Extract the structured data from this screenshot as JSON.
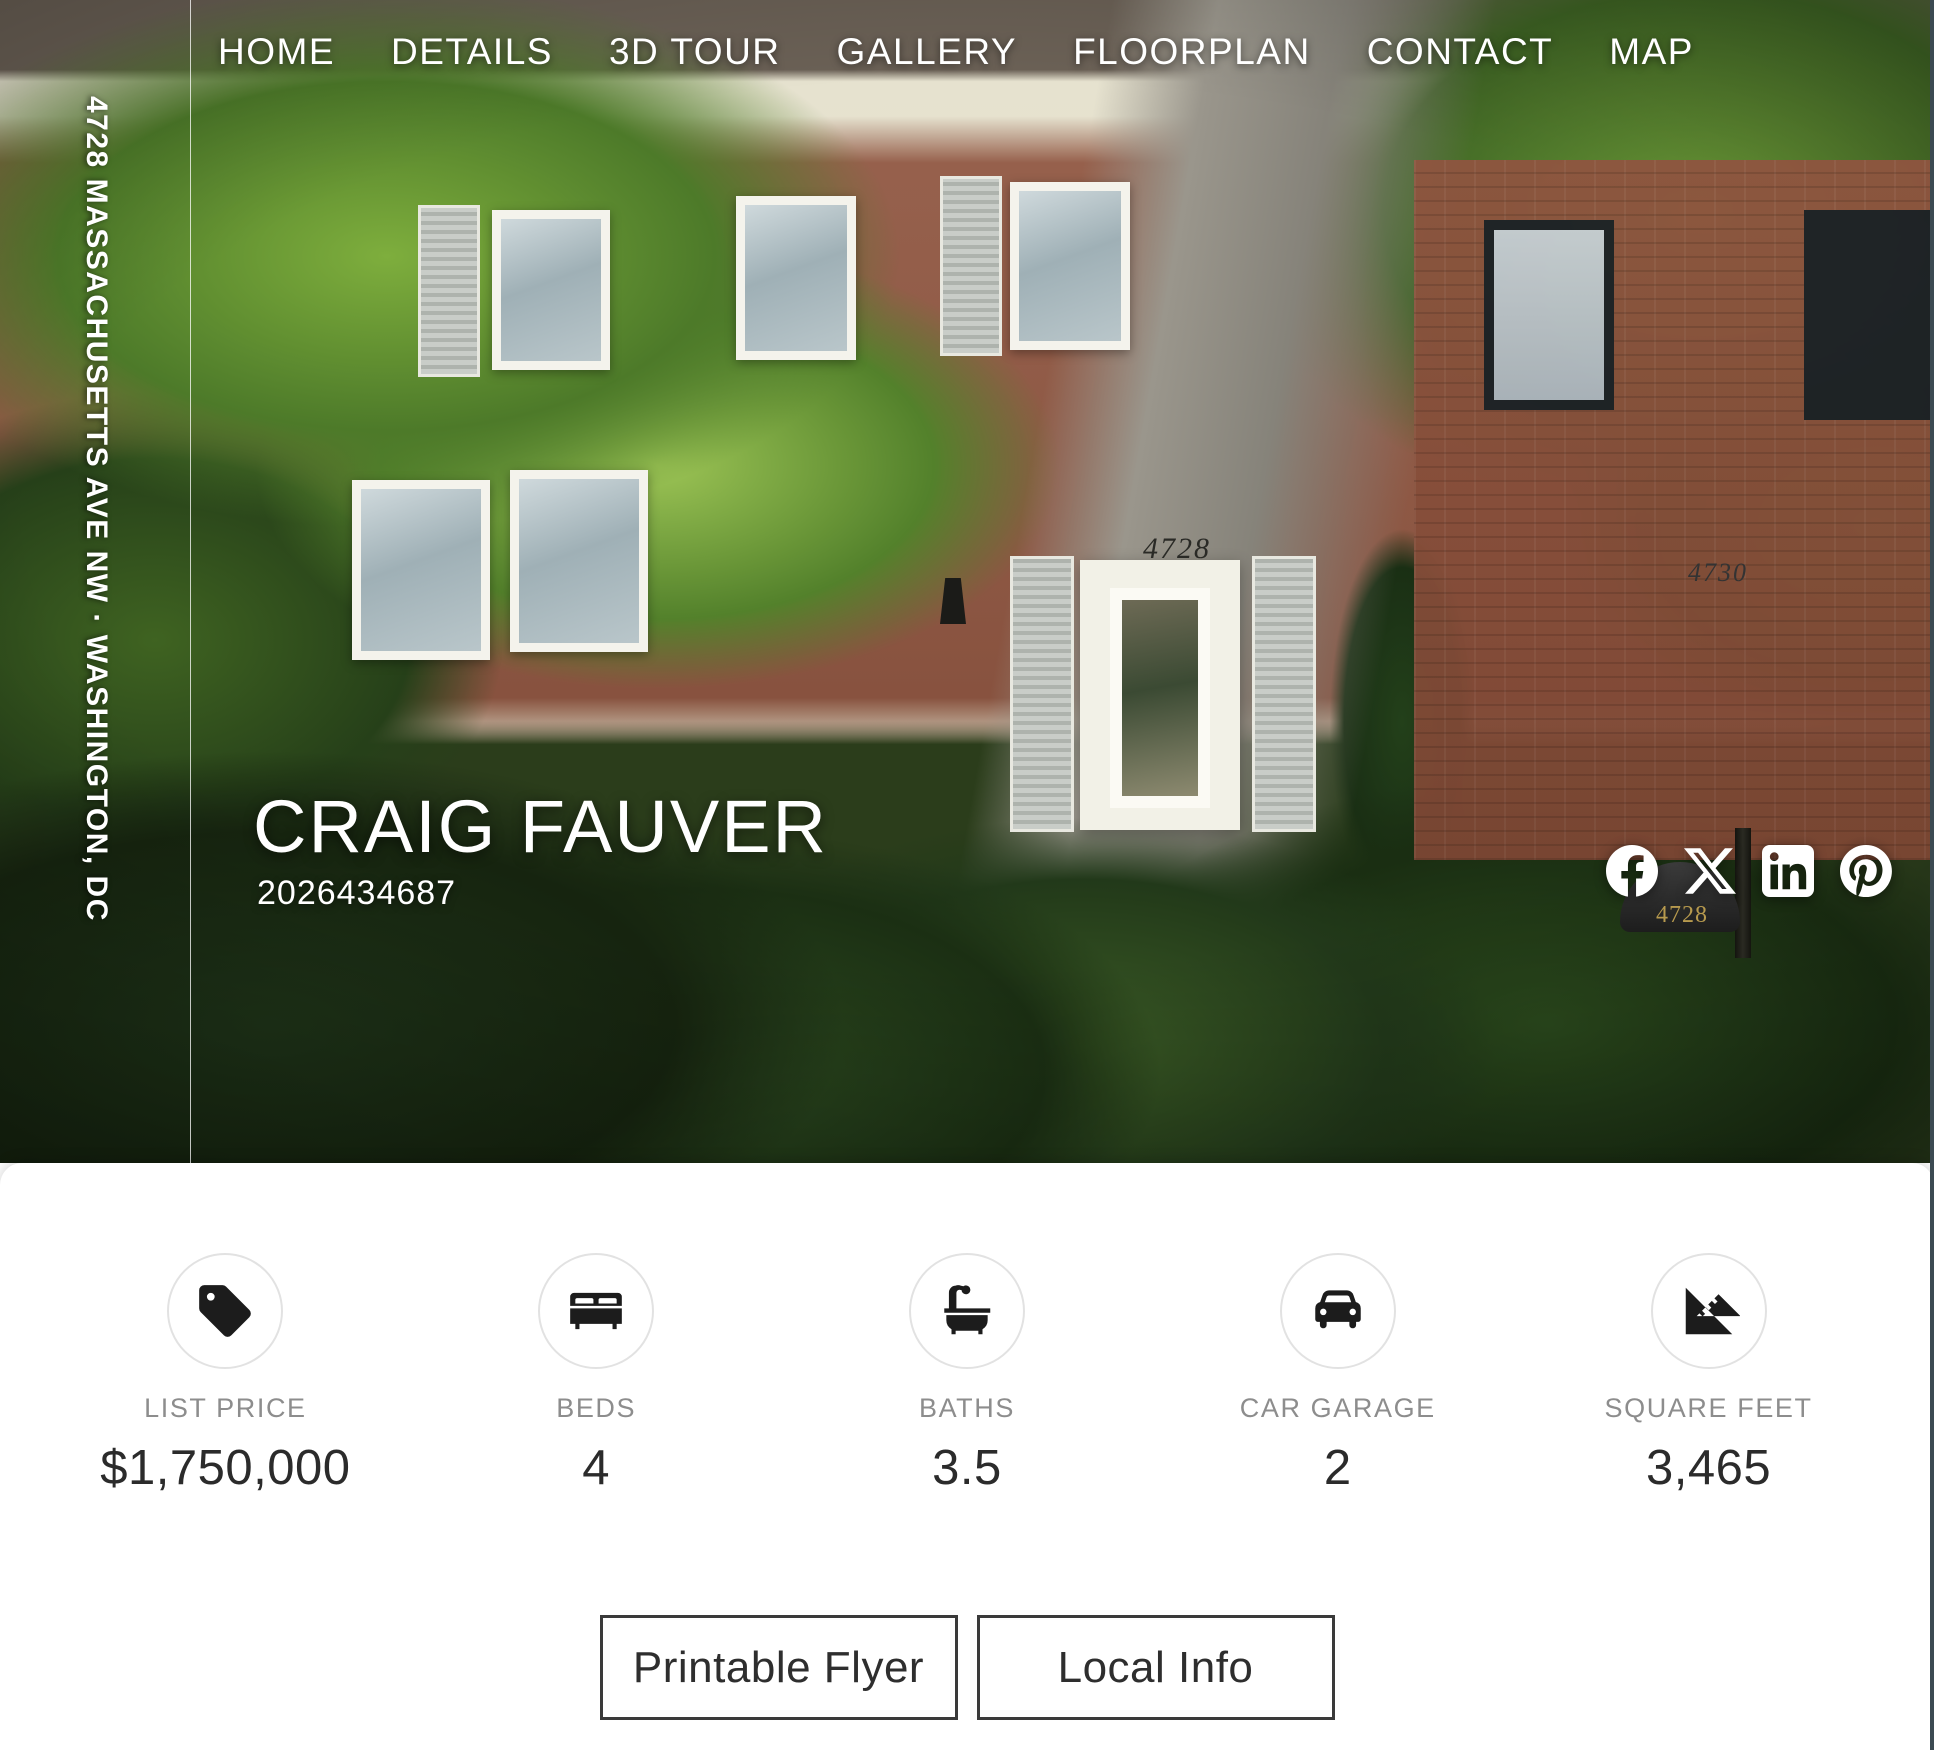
{
  "nav": {
    "items": [
      {
        "label": "HOME",
        "name": "nav-item-home"
      },
      {
        "label": "DETAILS",
        "name": "nav-item-details"
      },
      {
        "label": "3D TOUR",
        "name": "nav-item-3d-tour"
      },
      {
        "label": "GALLERY",
        "name": "nav-item-gallery"
      },
      {
        "label": "FLOORPLAN",
        "name": "nav-item-floorplan"
      },
      {
        "label": "CONTACT",
        "name": "nav-item-contact"
      },
      {
        "label": "MAP",
        "name": "nav-item-map"
      }
    ]
  },
  "hero": {
    "address_vertical": "4728 MASSACHUSETTS AVE NW  ·  WASHINGTON, DC",
    "house_number": "4728",
    "neighbor_house_number": "4730",
    "mailbox_number": "4728"
  },
  "agent": {
    "name": "CRAIG FAUVER",
    "phone": "2026434687"
  },
  "socials": [
    {
      "name": "facebook-icon",
      "label": "Facebook"
    },
    {
      "name": "x-twitter-icon",
      "label": "X"
    },
    {
      "name": "linkedin-icon",
      "label": "LinkedIn"
    },
    {
      "name": "pinterest-icon",
      "label": "Pinterest"
    }
  ],
  "stats": [
    {
      "icon": "price-tag-icon",
      "label": "LIST PRICE",
      "value": "$1,750,000"
    },
    {
      "icon": "bed-icon",
      "label": "BEDS",
      "value": "4"
    },
    {
      "icon": "bathtub-icon",
      "label": "BATHS",
      "value": "3.5"
    },
    {
      "icon": "car-icon",
      "label": "CAR GARAGE",
      "value": "2"
    },
    {
      "icon": "ruler-icon",
      "label": "SQUARE FEET",
      "value": "3,465"
    }
  ],
  "cta": {
    "printable_flyer": "Printable Flyer",
    "local_info": "Local Info"
  },
  "colors": {
    "card_background": "#ffffff",
    "label_gray": "#8d8d8d",
    "value_dark": "#2b2b2b",
    "button_border": "#3a3a3a",
    "nav_text": "#ffffff"
  }
}
